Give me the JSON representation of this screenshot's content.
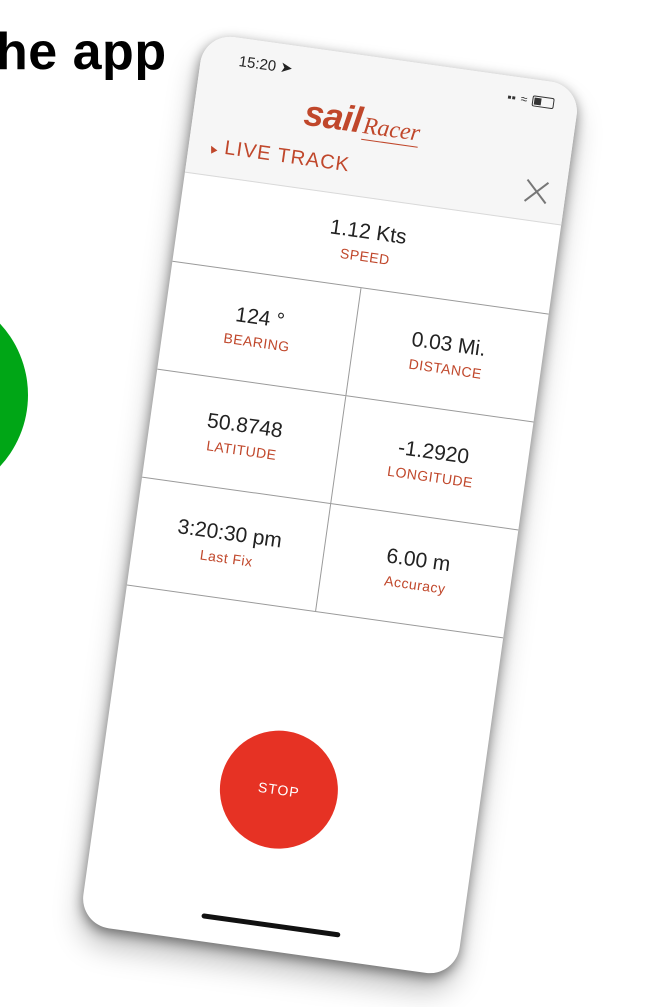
{
  "caption": {
    "text": "he app"
  },
  "status_bar": {
    "time": "15:20",
    "location_icon": "location-arrow-icon",
    "signal_icon": "cellular-signal-icon",
    "wifi_icon": "wifi-icon",
    "battery_icon": "battery-icon"
  },
  "header": {
    "logo_sail": "sail",
    "logo_racer": "Racer",
    "title": "LIVE TRACK",
    "title_icon": "location-arrow-icon",
    "close_icon": "close-icon"
  },
  "metrics": {
    "speed": {
      "value": "1.12 Kts",
      "label": "SPEED"
    },
    "bearing": {
      "value": "124 °",
      "label": "BEARING"
    },
    "distance": {
      "value": "0.03 Mi.",
      "label": "DISTANCE"
    },
    "latitude": {
      "value": "50.8748",
      "label": "LATITUDE"
    },
    "longitude": {
      "value": "-1.2920",
      "label": "LONGITUDE"
    },
    "last_fix": {
      "value": "3:20:30 pm",
      "label": "Last Fix"
    },
    "accuracy": {
      "value": "6.00 m",
      "label": "Accuracy"
    }
  },
  "stop_button": {
    "label": "STOP"
  },
  "colors": {
    "accent": "#c0472b",
    "stop": "#e63224",
    "green": "#00a616"
  }
}
